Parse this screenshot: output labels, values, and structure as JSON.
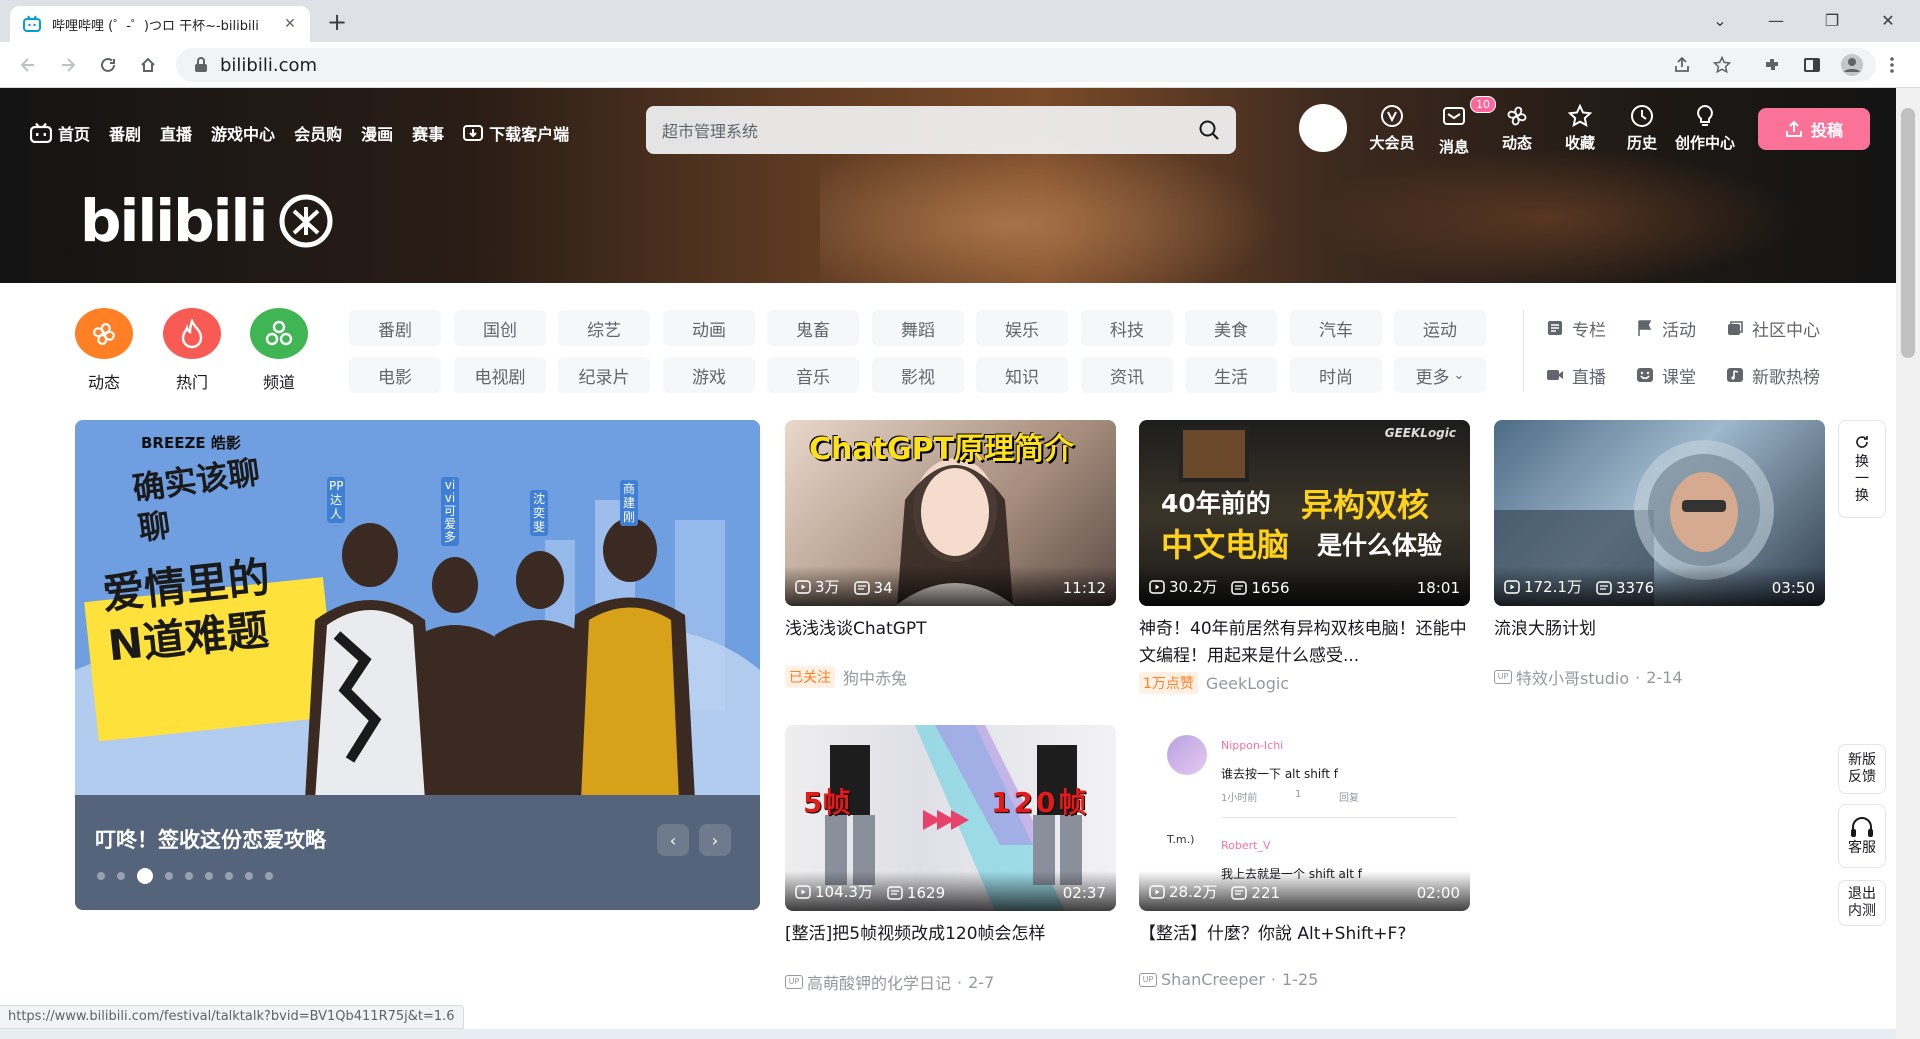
{
  "browser": {
    "tab_title": "哔哩哔哩 (゜-゜)つロ 干杯~-bilibili",
    "url": "bilibili.com",
    "status_url": "https://www.bilibili.com/festival/talktalk?bvid=BV1Qb411R75j&t=1.6"
  },
  "header": {
    "nav": [
      "首页",
      "番剧",
      "直播",
      "游戏中心",
      "会员购",
      "漫画",
      "赛事",
      "下载客户端"
    ],
    "search_placeholder": "超市管理系统",
    "right": [
      {
        "label": "大会员",
        "icon": "vip-icon"
      },
      {
        "label": "消息",
        "icon": "message-icon",
        "badge": "10"
      },
      {
        "label": "动态",
        "icon": "dynamic-icon"
      },
      {
        "label": "收藏",
        "icon": "star-icon"
      },
      {
        "label": "历史",
        "icon": "history-icon"
      },
      {
        "label": "创作中心",
        "icon": "bulb-icon"
      }
    ],
    "upload_label": "投稿",
    "logo_text": "bilibili"
  },
  "channels": {
    "big": [
      {
        "label": "动态",
        "color": "#ff7f24"
      },
      {
        "label": "热门",
        "color": "#f85a54"
      },
      {
        "label": "频道",
        "color": "#3fb653"
      }
    ],
    "row1": [
      "番剧",
      "国创",
      "综艺",
      "动画",
      "鬼畜",
      "舞蹈",
      "娱乐",
      "科技",
      "美食",
      "汽车",
      "运动"
    ],
    "row2": [
      "电影",
      "电视剧",
      "纪录片",
      "游戏",
      "音乐",
      "影视",
      "知识",
      "资讯",
      "生活",
      "时尚",
      "更多"
    ],
    "right": [
      {
        "label": "专栏",
        "icon": "article-icon"
      },
      {
        "label": "活动",
        "icon": "flag-icon"
      },
      {
        "label": "社区中心",
        "icon": "community-icon"
      },
      {
        "label": "直播",
        "icon": "live-icon"
      },
      {
        "label": "课堂",
        "icon": "class-icon"
      },
      {
        "label": "新歌热榜",
        "icon": "music-icon"
      }
    ]
  },
  "carousel": {
    "title": "叮咚！签收这份恋爱攻略",
    "poster_heading": "爱情里的\nN道难题",
    "poster_brand": "BREEZE 皓影",
    "poster_series": "确实该聊聊",
    "poster_names": [
      "PP达人",
      "vivi可爱多",
      "沈奕斐",
      "商建刚"
    ],
    "dot_count": 9,
    "active_dot": 2
  },
  "videos": [
    {
      "title": "浅浅浅谈ChatGPT",
      "views": "3万",
      "danmaku": "34",
      "duration": "11:12",
      "tag": "已关注",
      "author": "狗中赤兔",
      "date": "",
      "thumb_text": "ChatGPT原理简介"
    },
    {
      "title": "神奇！40年前居然有异构双核电脑！还能中文编程！用起来是什么感受...",
      "views": "30.2万",
      "danmaku": "1656",
      "duration": "18:01",
      "tag": "1万点赞",
      "author": "GeekLogic",
      "date": "",
      "thumb_text_a": "40年前的",
      "thumb_text_b": "异构双核",
      "thumb_text_c": "中文电脑",
      "thumb_text_d": "是什么体验",
      "thumb_brand": "GEEKLogic"
    },
    {
      "title": "流浪大肠计划",
      "views": "172.1万",
      "danmaku": "3376",
      "duration": "03:50",
      "tag": "",
      "author": "特效小哥studio",
      "date": "2-14"
    },
    {
      "title": "[整活]把5帧视频改成120帧会怎样",
      "views": "104.3万",
      "danmaku": "1629",
      "duration": "02:37",
      "tag": "",
      "author": "高萌酸钾的化学日记",
      "date": "2-7",
      "thumb_text_a": "5帧",
      "thumb_text_b": "120帧"
    },
    {
      "title": "【整活】什麼？你說 Alt+Shift+F?",
      "views": "28.2万",
      "danmaku": "221",
      "duration": "02:00",
      "tag": "",
      "author": "ShanCreeper",
      "date": "1-25",
      "c1_name": "Nippon-Ichi",
      "c1_text": "谁去按一下 alt shift f",
      "c1_time": "1小时前",
      "c1_likes": "1",
      "c1_reply": "回复",
      "c2_name": "Robert_V",
      "c2_text": "我上去就是一个 shift alt f"
    }
  ],
  "side": {
    "refresh": "换一换",
    "feedback": "新版反馈",
    "service": "客服",
    "exit": "退出内测"
  }
}
